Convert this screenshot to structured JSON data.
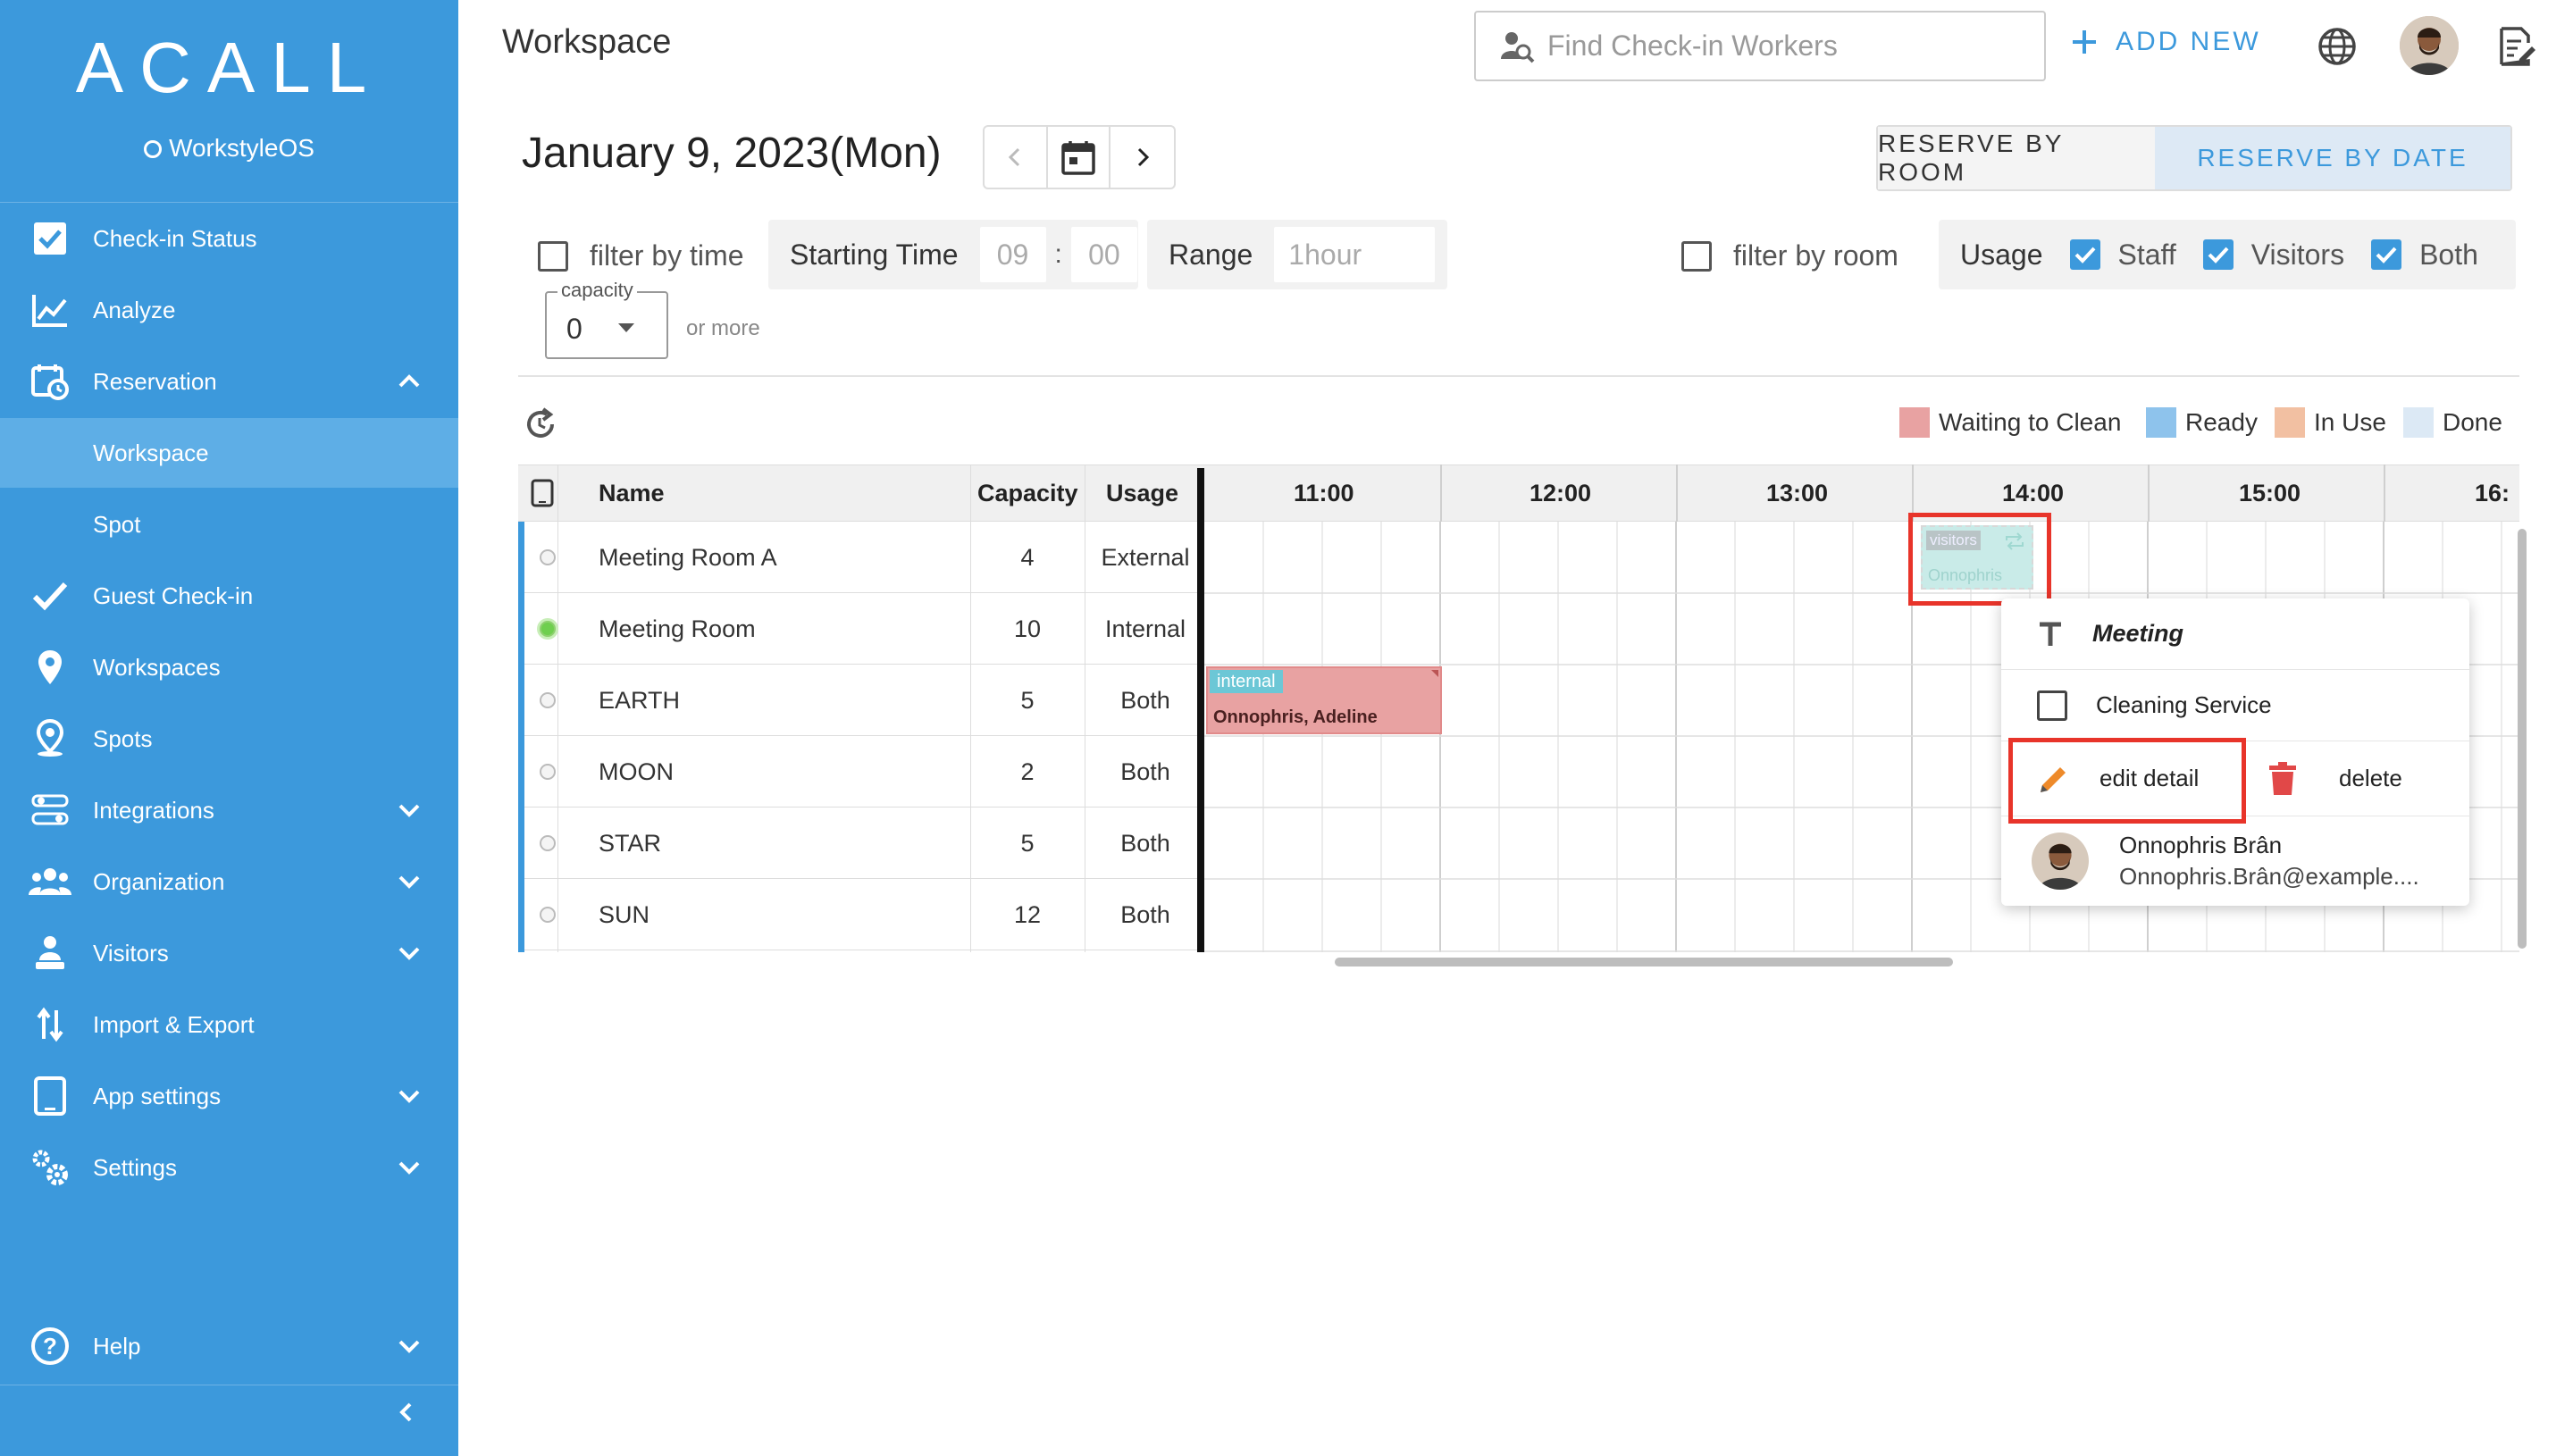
{
  "sidebar": {
    "logo": "ACALL",
    "sublogo": "WorkstyleOS",
    "items": [
      {
        "label": "Check-in Status"
      },
      {
        "label": "Analyze"
      },
      {
        "label": "Reservation"
      },
      {
        "label": "Workspace"
      },
      {
        "label": "Spot"
      },
      {
        "label": "Guest Check-in"
      },
      {
        "label": "Workspaces"
      },
      {
        "label": "Spots"
      },
      {
        "label": "Integrations"
      },
      {
        "label": "Organization"
      },
      {
        "label": "Visitors"
      },
      {
        "label": "Import & Export"
      },
      {
        "label": "App settings"
      },
      {
        "label": "Settings"
      },
      {
        "label": "Help"
      }
    ]
  },
  "header": {
    "title": "Workspace",
    "search_placeholder": "Find Check-in Workers",
    "add_new": "ADD NEW"
  },
  "datebar": {
    "date": "January 9, 2023(Mon)",
    "reserve_by_room": "RESERVE BY ROOM",
    "reserve_by_date": "RESERVE BY DATE"
  },
  "filters": {
    "filter_by_time": "filter by time",
    "starting_time_label": "Starting Time",
    "hour": "09",
    "colon": ":",
    "minute": "00",
    "range_label": "Range",
    "range_value": "1hour",
    "filter_by_room": "filter by room",
    "usage_label": "Usage",
    "staff": "Staff",
    "visitors": "Visitors",
    "both": "Both",
    "capacity_label": "capacity",
    "capacity_value": "0",
    "or_more": "or more"
  },
  "legend": [
    {
      "label": "Waiting to Clean",
      "color": "#e8a2a2"
    },
    {
      "label": "Ready",
      "color": "#8ec3ec"
    },
    {
      "label": "In Use",
      "color": "#f2c0a2"
    },
    {
      "label": "Done",
      "color": "#dce9f5"
    }
  ],
  "table": {
    "headers": {
      "name": "Name",
      "capacity": "Capacity",
      "usage": "Usage"
    },
    "times": [
      "11:00",
      "12:00",
      "13:00",
      "14:00",
      "15:00",
      "16:"
    ],
    "rows": [
      {
        "name": "Meeting Room A",
        "capacity": "4",
        "usage": "External"
      },
      {
        "name": "Meeting Room",
        "capacity": "10",
        "usage": "Internal"
      },
      {
        "name": "EARTH",
        "capacity": "5",
        "usage": "Both"
      },
      {
        "name": "MOON",
        "capacity": "2",
        "usage": "Both"
      },
      {
        "name": "STAR",
        "capacity": "5",
        "usage": "Both"
      },
      {
        "name": "SUN",
        "capacity": "12",
        "usage": "Both"
      }
    ]
  },
  "reservations": {
    "earth": {
      "tag": "internal",
      "names": "Onnophris, Adeline"
    },
    "room_a": {
      "tag": "visitors",
      "names": "Onnophris"
    }
  },
  "popover": {
    "title": "Meeting",
    "cleaning": "Cleaning Service",
    "edit": "edit detail",
    "delete": "delete",
    "user_name": "Onnophris Brân",
    "user_email": "Onnophris.Brân@example...."
  }
}
